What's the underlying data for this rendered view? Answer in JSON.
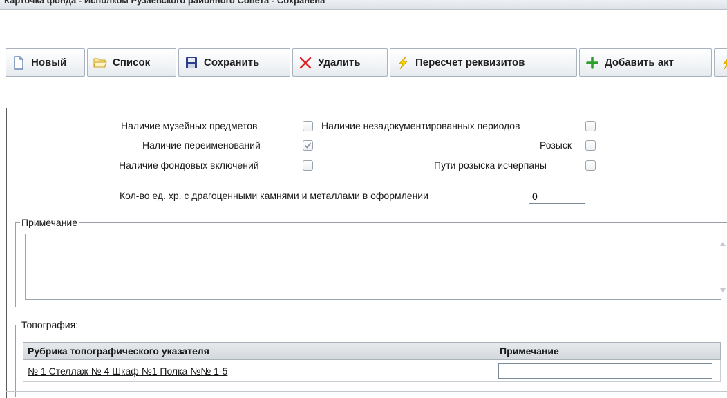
{
  "title": "Карточка фонда - Исполком Рузаевского районного Совета - Сохранена",
  "toolbar": {
    "new_label": "Новый",
    "list_label": "Список",
    "save_label": "Сохранить",
    "delete_label": "Удалить",
    "recalc_label": "Пересчет реквизитов",
    "add_act_label": "Добавить акт"
  },
  "flags": {
    "museum_items": {
      "label": "Наличие музейных предметов",
      "checked": false
    },
    "undocumented_periods": {
      "label": "Наличие незадокументированных периодов",
      "checked": false
    },
    "renamings": {
      "label": "Наличие переименований",
      "checked": true
    },
    "search": {
      "label": "Розыск",
      "checked": false
    },
    "fund_inclusions": {
      "label": "Наличие фондовых включений",
      "checked": false
    },
    "search_exhausted": {
      "label": "Пути розыска исчерпаны",
      "checked": false
    }
  },
  "precious": {
    "label": "Кол-во ед. хр. с драгоценными камнями и металлами в оформлении",
    "value": "0"
  },
  "note": {
    "legend": "Примечание",
    "value": ""
  },
  "topography": {
    "legend": "Топография:",
    "columns": [
      "Рубрика топографического указателя",
      "Примечание"
    ],
    "rows": [
      {
        "rubric": "№ 1 Стеллаж № 4 Шкаф №1 Полка №№ 1-5",
        "note": ""
      }
    ]
  },
  "colors": {
    "delete_icon": "#e02020",
    "add_icon": "#2e9e2e",
    "save_icon": "#2c3f8a"
  }
}
